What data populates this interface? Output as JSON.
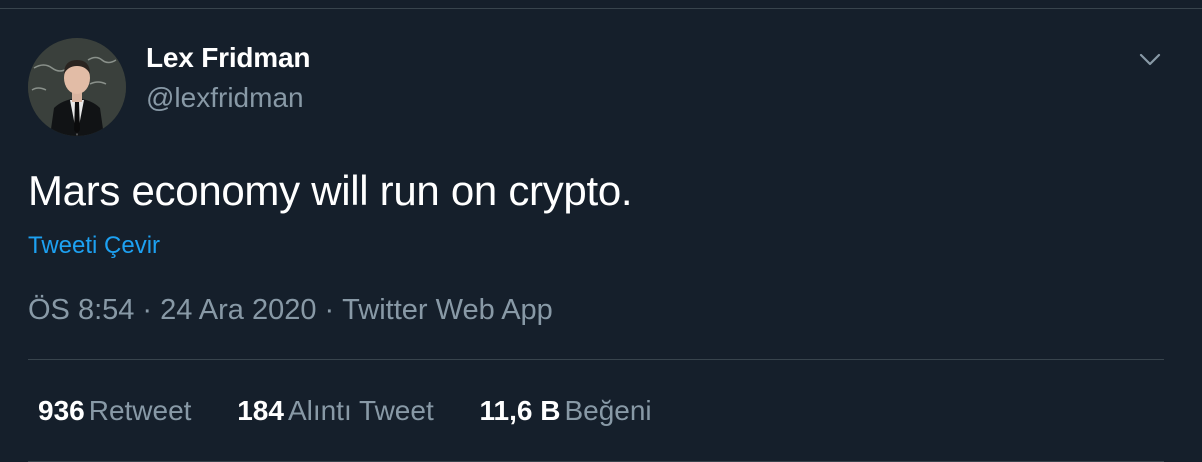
{
  "author": {
    "name": "Lex Fridman",
    "handle": "@lexfridman"
  },
  "tweet": {
    "text": "Mars economy will run on crypto.",
    "translate_label": "Tweeti Çevir"
  },
  "meta": {
    "time": "ÖS 8:54",
    "separator": "·",
    "date": "24 Ara 2020",
    "source": "Twitter Web App"
  },
  "stats": [
    {
      "value": "936",
      "label": "Retweet"
    },
    {
      "value": "184",
      "label": "Alıntı Tweet"
    },
    {
      "value": "11,6 B",
      "label": "Beğeni"
    }
  ],
  "icons": {
    "caret": "chevron-down-icon"
  },
  "colors": {
    "background": "#151f2b",
    "text": "#ffffff",
    "secondary_text": "#8899a6",
    "link": "#1da1f2",
    "border": "#38444d"
  }
}
